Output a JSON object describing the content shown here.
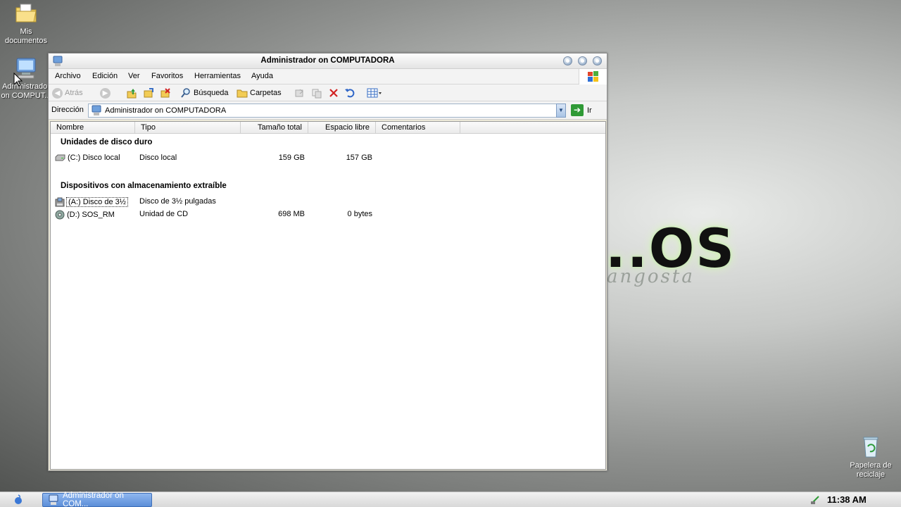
{
  "desktop": {
    "icons": [
      {
        "label": "Mis documentos"
      },
      {
        "label": "Administrador on COMPUT..."
      },
      {
        "label": "Papelera de reciclaje"
      }
    ],
    "wallpaper_text": "..OS",
    "wallpaper_subtext": "angosta"
  },
  "window": {
    "title": "Administrador on COMPUTADORA",
    "menu": [
      "Archivo",
      "Edición",
      "Ver",
      "Favoritos",
      "Herramientas",
      "Ayuda"
    ],
    "toolbar": {
      "back_label": "Atrás",
      "search_label": "Búsqueda",
      "folders_label": "Carpetas"
    },
    "address": {
      "label": "Dirección",
      "value": "Administrador on COMPUTADORA",
      "go_label": "Ir"
    },
    "columns": [
      "Nombre",
      "Tipo",
      "Tamaño total",
      "Espacio libre",
      "Comentarios"
    ],
    "groups": [
      {
        "title": "Unidades de disco duro",
        "items": [
          {
            "name": "(C:) Disco local",
            "type": "Disco local",
            "size": "159 GB",
            "free": "157 GB",
            "icon": "hard-drive-icon"
          }
        ]
      },
      {
        "title": "Dispositivos con almacenamiento extraíble",
        "items": [
          {
            "name": "(A:) Disco de 3½",
            "type": "Disco de 3½ pulgadas",
            "size": "",
            "free": "",
            "icon": "floppy-icon"
          },
          {
            "name": "(D:) SOS_RM",
            "type": "Unidad de CD",
            "size": "698 MB",
            "free": "0 bytes",
            "icon": "cd-drive-icon"
          }
        ]
      }
    ]
  },
  "taskbar": {
    "task_label": "Administrador on COM...",
    "clock": "11:38 AM"
  },
  "colors": {
    "task_button": "#5c8ed8",
    "go_button": "#2f9a36",
    "delete_icon": "#d22222"
  }
}
